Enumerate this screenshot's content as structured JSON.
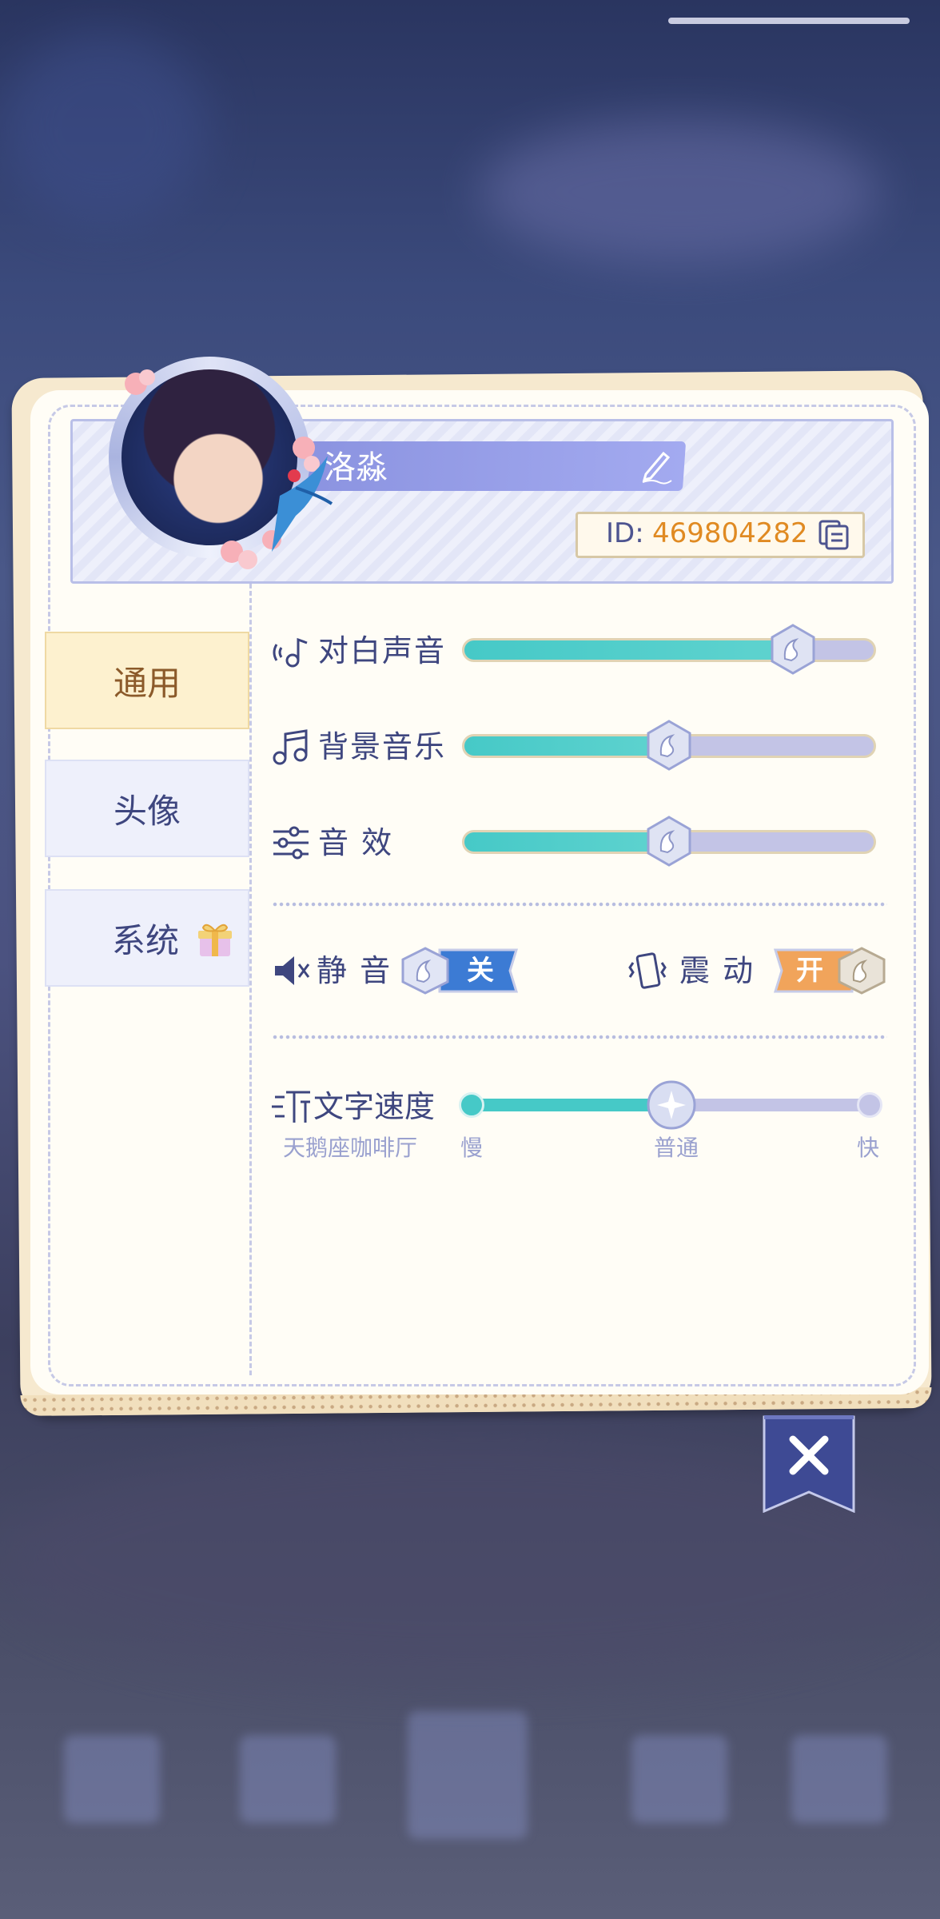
{
  "profile": {
    "name": "洛淼",
    "id_label": "ID:",
    "id_value": "469804282"
  },
  "tabs": [
    {
      "label": "通用",
      "active": true
    },
    {
      "label": "头像",
      "active": false
    },
    {
      "label": "系统",
      "active": false
    }
  ],
  "audio": {
    "dialogue": {
      "label": "对白声音",
      "level": 0.8
    },
    "bgm": {
      "label": "背景音乐",
      "level": 0.5
    },
    "sfx": {
      "label": "音 效",
      "level": 0.5
    }
  },
  "toggles": {
    "mute": {
      "label": "静 音",
      "state_text": "关",
      "on": false
    },
    "vibrate": {
      "label": "震 动",
      "state_text": "开",
      "on": true
    }
  },
  "text_speed": {
    "label": "文字速度",
    "slow": "慢",
    "normal": "普通",
    "fast": "快",
    "level": 0.5
  },
  "watermark": "天鹅座咖啡厅",
  "colors": {
    "accent_teal": "#46c9c7",
    "track": "#c3c4e6",
    "text_primary": "#3e467f",
    "id_orange": "#e08a22",
    "close_bg": "#3e4a94"
  }
}
